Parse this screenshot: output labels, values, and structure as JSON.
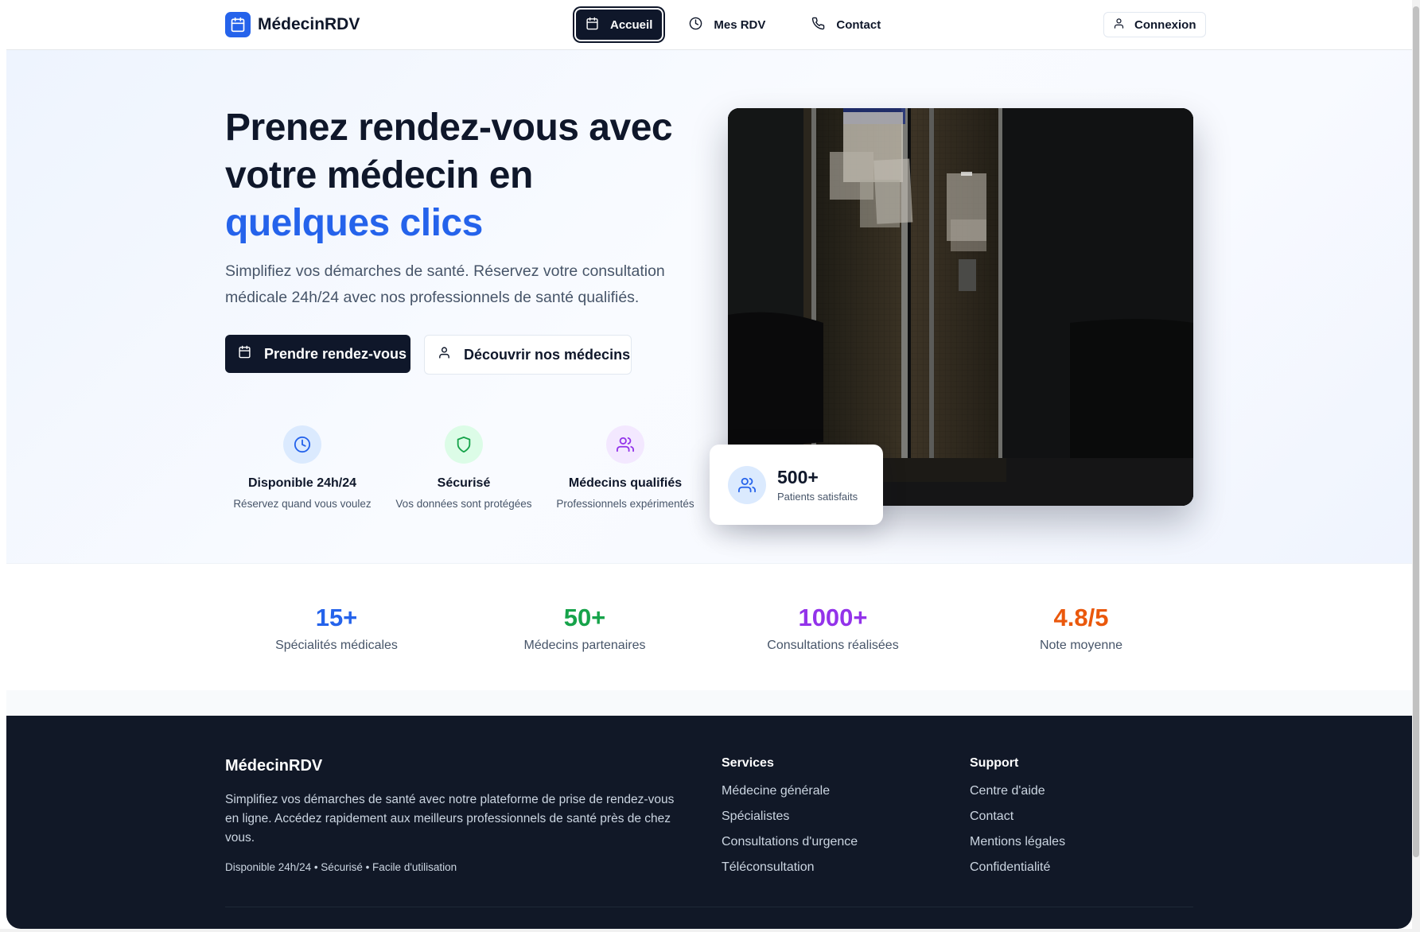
{
  "navbar": {
    "brand": "MédecinRDV",
    "links": [
      {
        "label": "Accueil",
        "icon": "calendar-icon",
        "active": true
      },
      {
        "label": "Mes RDV",
        "icon": "clock-icon",
        "active": false
      },
      {
        "label": "Contact",
        "icon": "phone-icon",
        "active": false
      }
    ],
    "login_label": "Connexion"
  },
  "hero": {
    "title_line1": "Prenez rendez-vous avec",
    "title_line2": "votre médecin en",
    "title_accent": "quelques clics",
    "subtitle": "Simplifiez vos démarches de santé. Réservez votre consultation médicale 24h/24 avec nos professionnels de santé qualifiés.",
    "cta_primary": "Prendre rendez-vous",
    "cta_secondary": "Découvrir nos médecins",
    "features": [
      {
        "title": "Disponible 24h/24",
        "desc": "Réservez quand vous voulez",
        "icon": "clock-icon",
        "color": "#2563eb",
        "bg": "#dbeafe"
      },
      {
        "title": "Sécurisé",
        "desc": "Vos données sont protégées",
        "icon": "shield-icon",
        "color": "#16a34a",
        "bg": "#dcfce7"
      },
      {
        "title": "Médecins qualifiés",
        "desc": "Professionnels expérimentés",
        "icon": "users-icon",
        "color": "#9333ea",
        "bg": "#f3e8ff"
      }
    ],
    "stat_card": {
      "value": "500+",
      "label": "Patients satisfaits"
    }
  },
  "stats": [
    {
      "value": "15+",
      "label": "Spécialités médicales",
      "color": "#2563eb"
    },
    {
      "value": "50+",
      "label": "Médecins partenaires",
      "color": "#16a34a"
    },
    {
      "value": "1000+",
      "label": "Consultations réalisées",
      "color": "#9333ea"
    },
    {
      "value": "4.8/5",
      "label": "Note moyenne",
      "color": "#ea580c"
    }
  ],
  "footer": {
    "brand": "MédecinRDV",
    "description": "Simplifiez vos démarches de santé avec notre plateforme de prise de rendez-vous en ligne. Accédez rapidement aux meilleurs professionnels de santé près de chez vous.",
    "tagline": "Disponible 24h/24 • Sécurisé • Facile d'utilisation",
    "columns": [
      {
        "title": "Services",
        "links": [
          "Médecine générale",
          "Spécialistes",
          "Consultations d'urgence",
          "Téléconsultation"
        ]
      },
      {
        "title": "Support",
        "links": [
          "Centre d'aide",
          "Contact",
          "Mentions légales",
          "Confidentialité"
        ]
      }
    ]
  }
}
